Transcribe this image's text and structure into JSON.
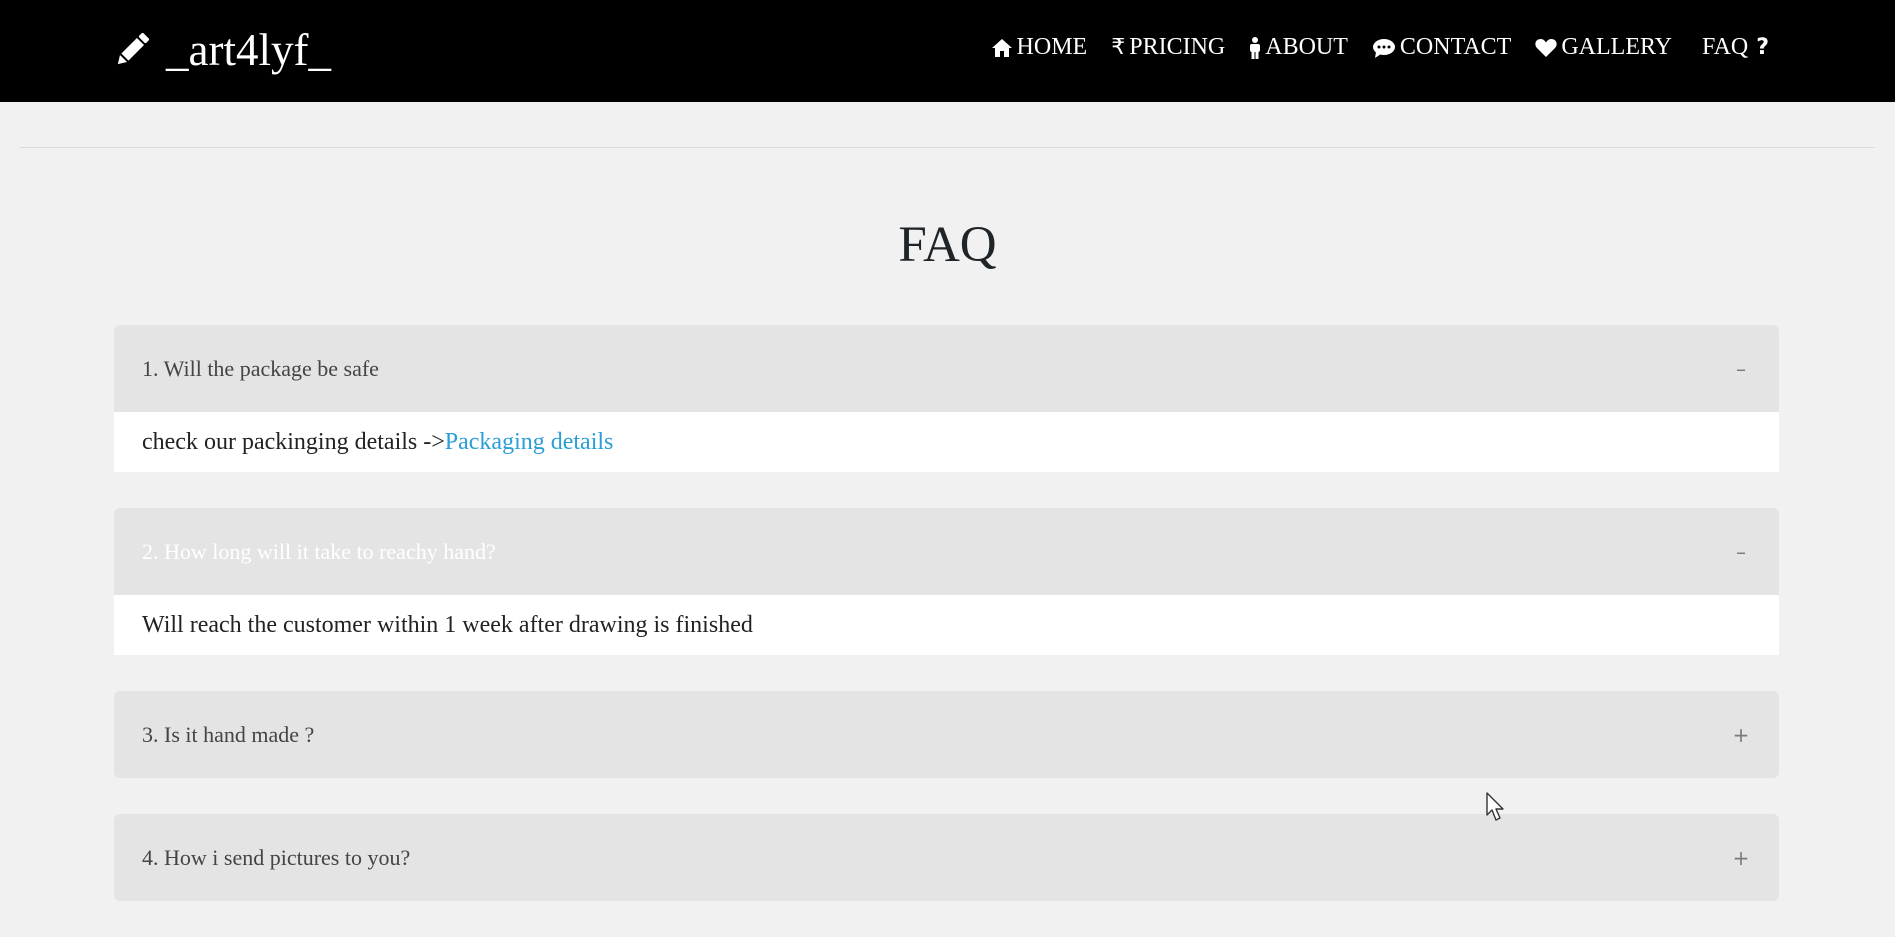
{
  "header": {
    "brand": "_art4lyf_",
    "brand_icon": "pencil-icon",
    "colors": {
      "background": "#000000",
      "text": "#ffffff"
    },
    "nav": [
      {
        "icon": "home-icon",
        "label": "HOME"
      },
      {
        "icon": "rupee-icon",
        "label": "PRICING"
      },
      {
        "icon": "person-icon",
        "label": "ABOUT"
      },
      {
        "icon": "comment-icon",
        "label": "CONTACT"
      },
      {
        "icon": "heart-icon",
        "label": "GALLERY"
      },
      {
        "icon": "question-icon",
        "label": "FAQ"
      }
    ]
  },
  "main": {
    "title": "FAQ",
    "faq": [
      {
        "question": "1. Will the package be safe",
        "toggle": "–",
        "expanded": true,
        "answer_text": "check our packinging details ->",
        "answer_link": "Packaging details"
      },
      {
        "question": "2. How long will it take to reachy hand?",
        "toggle": "–",
        "expanded": true,
        "answer_text": "Will reach the customer within 1 week after drawing is finished"
      },
      {
        "question": "3. Is it hand made ?",
        "toggle": "+",
        "expanded": false
      },
      {
        "question": "4. How i send pictures to you?",
        "toggle": "+",
        "expanded": false
      }
    ],
    "colors": {
      "page_background": "#f1f1f1",
      "question_background": "#e4e4e4",
      "answer_background": "#ffffff",
      "link": "#2a9fd6"
    }
  }
}
